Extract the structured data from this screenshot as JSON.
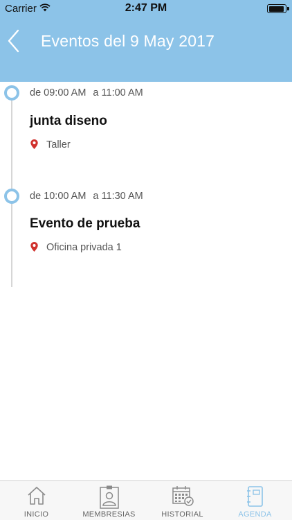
{
  "status_bar": {
    "carrier": "Carrier",
    "time": "2:47 PM",
    "wifi_icon": "wifi-icon",
    "battery_icon": "battery-icon"
  },
  "header": {
    "title": "Eventos del 9 May 2017",
    "back_icon": "chevron-left-icon",
    "background_color": "#8cc3e8"
  },
  "events": [
    {
      "from_label": "de 09:00 AM",
      "to_label": "a 11:00 AM",
      "title": "junta diseno",
      "location": "Taller",
      "location_icon": "map-pin-icon"
    },
    {
      "from_label": "de 10:00 AM",
      "to_label": "a 11:30 AM",
      "title": "Evento de prueba",
      "location": "Oficina privada 1",
      "location_icon": "map-pin-icon"
    }
  ],
  "tabs": [
    {
      "label": "INICIO",
      "icon": "home-icon",
      "active": false
    },
    {
      "label": "MEMBRESIAS",
      "icon": "id-card-icon",
      "active": false
    },
    {
      "label": "HISTORIAL",
      "icon": "calendar-check-icon",
      "active": false
    },
    {
      "label": "AGENDA",
      "icon": "notebook-icon",
      "active": true
    }
  ],
  "colors": {
    "accent": "#8cc3e8",
    "pin": "#d0312d",
    "tab_inactive": "#666666"
  }
}
